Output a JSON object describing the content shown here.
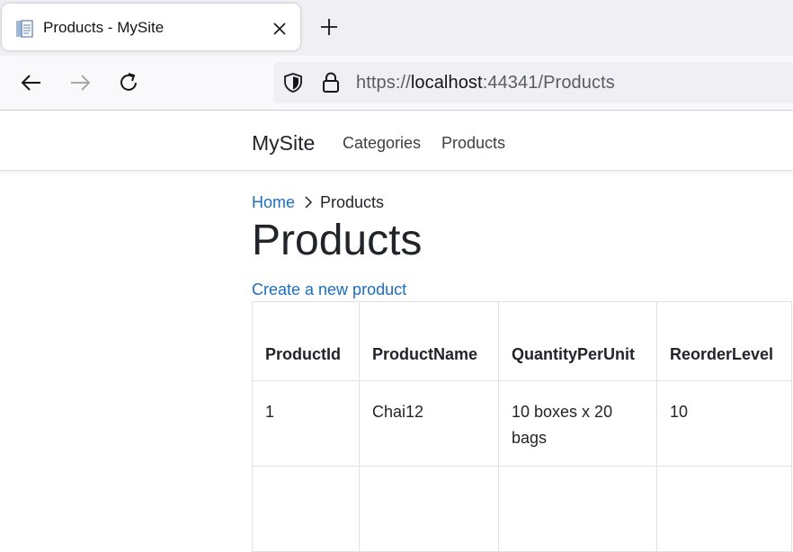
{
  "browser": {
    "tab": {
      "title": "Products - MySite",
      "favicon": "document-icon",
      "close_icon": "close-icon"
    },
    "new_tab_icon": "plus-icon",
    "nav": {
      "back_icon": "arrow-left-icon",
      "forward_icon": "arrow-right-icon",
      "reload_icon": "reload-icon"
    },
    "url": {
      "scheme": "https://",
      "host": "localhost",
      "port_path": ":44341/Products",
      "shield_icon": "shield-icon",
      "lock_icon": "lock-icon"
    }
  },
  "site": {
    "brand": "MySite",
    "nav_links": [
      "Categories",
      "Products"
    ]
  },
  "breadcrumb": {
    "home": "Home",
    "current": "Products",
    "separator_icon": "chevron-right-icon"
  },
  "page": {
    "title": "Products",
    "create_link": "Create a new product"
  },
  "table": {
    "headers": [
      "ProductId",
      "ProductName",
      "QuantityPerUnit",
      "ReorderLevel"
    ],
    "rows": [
      [
        "1",
        "Chai12",
        "10 boxes x 20 bags",
        "10"
      ]
    ]
  },
  "colors": {
    "link": "#1b6ec2",
    "text": "#212529",
    "border": "#dee2e6"
  }
}
